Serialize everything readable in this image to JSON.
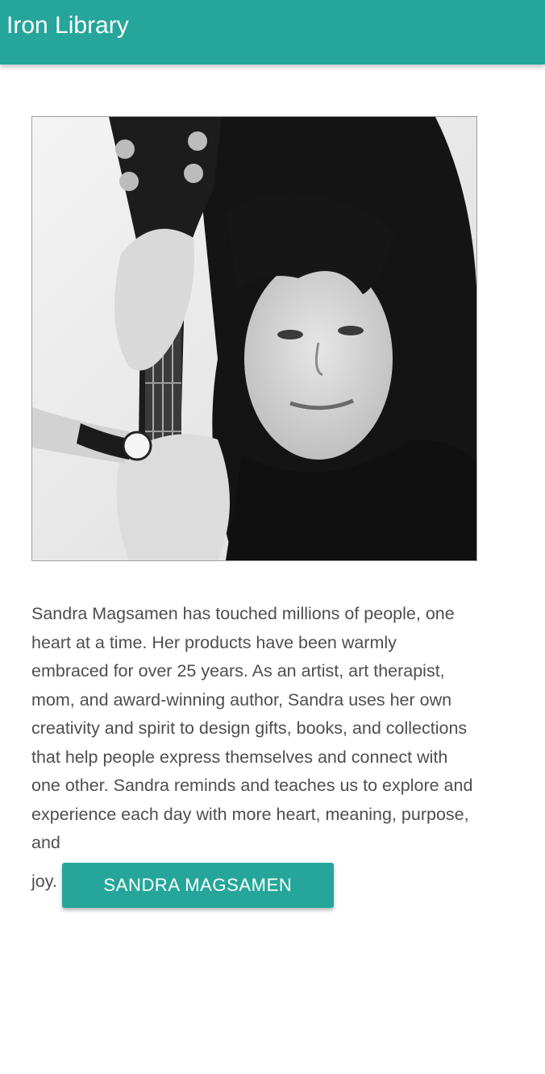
{
  "header": {
    "title": "Iron Library",
    "color": "#26a69a"
  },
  "author": {
    "bio": "Sandra Magsamen has touched millions of people, one heart at a time. Her products have been warmly embraced for over 25 years. As an artist, art therapist, mom, and award-winning author, Sandra uses her own creativity and spirit to design gifts, books, and collections that help people express themselves and connect with one other. Sandra reminds and teaches us to explore and experience each day with more heart, meaning, purpose, and",
    "bio_tail": "joy.",
    "button_label": "SANDRA MAGSAMEN",
    "photo_icon": "author-photo-woman-with-guitar"
  }
}
